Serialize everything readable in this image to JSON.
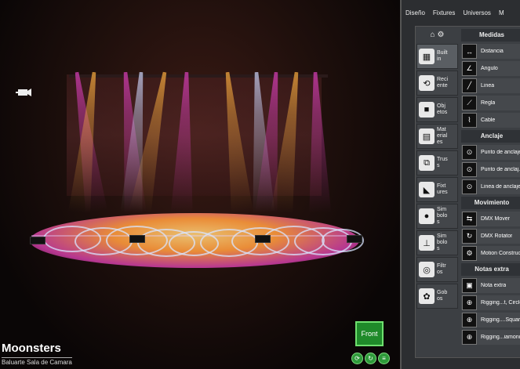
{
  "viewport": {
    "title": "Moonsters",
    "subtitle": "Baluarte Sala de Camara",
    "front_label": "Front",
    "beam_colors": {
      "magenta": "#e040c0",
      "amber": "#ffb040",
      "white": "#cfd8ff"
    },
    "floor_ring_color": "#d8e4ff",
    "view_buttons": [
      "refresh-icon",
      "rotate-icon",
      "menu-icon"
    ]
  },
  "panel": {
    "tabs": [
      "Diseño",
      "Fixtures",
      "Universos",
      "M"
    ],
    "categories": [
      {
        "label": "Built in",
        "icon": "grid-icon",
        "glyph": "▦",
        "active": true
      },
      {
        "label": "Reciente",
        "icon": "history-icon",
        "glyph": "⟲",
        "active": false
      },
      {
        "label": "Objetos",
        "icon": "cube-icon",
        "glyph": "■",
        "active": false
      },
      {
        "label": "Materiales",
        "icon": "brick-icon",
        "glyph": "▤",
        "active": false
      },
      {
        "label": "Truss",
        "icon": "truss-icon",
        "glyph": "⧉",
        "active": false
      },
      {
        "label": "Fixtures",
        "icon": "spotlight-icon",
        "glyph": "◣",
        "active": false
      },
      {
        "label": "Simbolos",
        "icon": "circle-icon",
        "glyph": "●",
        "active": false
      },
      {
        "label": "Simbolos",
        "icon": "plumb-icon",
        "glyph": "⊥",
        "active": false
      },
      {
        "label": "Filtros",
        "icon": "filter-icon",
        "glyph": "◎",
        "active": false
      },
      {
        "label": "Gobos",
        "icon": "gobo-icon",
        "glyph": "✿",
        "active": false
      }
    ],
    "sections": [
      {
        "title": "Medidas",
        "tools": [
          {
            "label": "Distancia",
            "glyph": "↔"
          },
          {
            "label": "Angulo",
            "glyph": "∠"
          },
          {
            "label": "Linea",
            "glyph": "╱"
          },
          {
            "label": "Regla",
            "glyph": "⟋"
          },
          {
            "label": "Cable",
            "glyph": "⌇"
          }
        ]
      },
      {
        "title": "Anclaje",
        "tools": [
          {
            "label": "Punto de anclaje",
            "glyph": "⊙"
          },
          {
            "label": "Punto de anclaj...",
            "glyph": "⊙"
          },
          {
            "label": "Linea de anclaje",
            "glyph": "⊙"
          }
        ]
      },
      {
        "title": "Movimiento",
        "tools": [
          {
            "label": "DMX Mover",
            "glyph": "⇆"
          },
          {
            "label": "DMX Rotator",
            "glyph": "↻"
          },
          {
            "label": "Motion Construct",
            "glyph": "⚙"
          }
        ]
      },
      {
        "title": "Notas extra",
        "tools": [
          {
            "label": "Nota extra",
            "glyph": "▣"
          },
          {
            "label": "Rigging...t, Circle",
            "glyph": "⊕"
          },
          {
            "label": "Rigging....Square",
            "glyph": "⊕"
          },
          {
            "label": "Rigging...iamond",
            "glyph": "⊕"
          }
        ]
      }
    ]
  }
}
